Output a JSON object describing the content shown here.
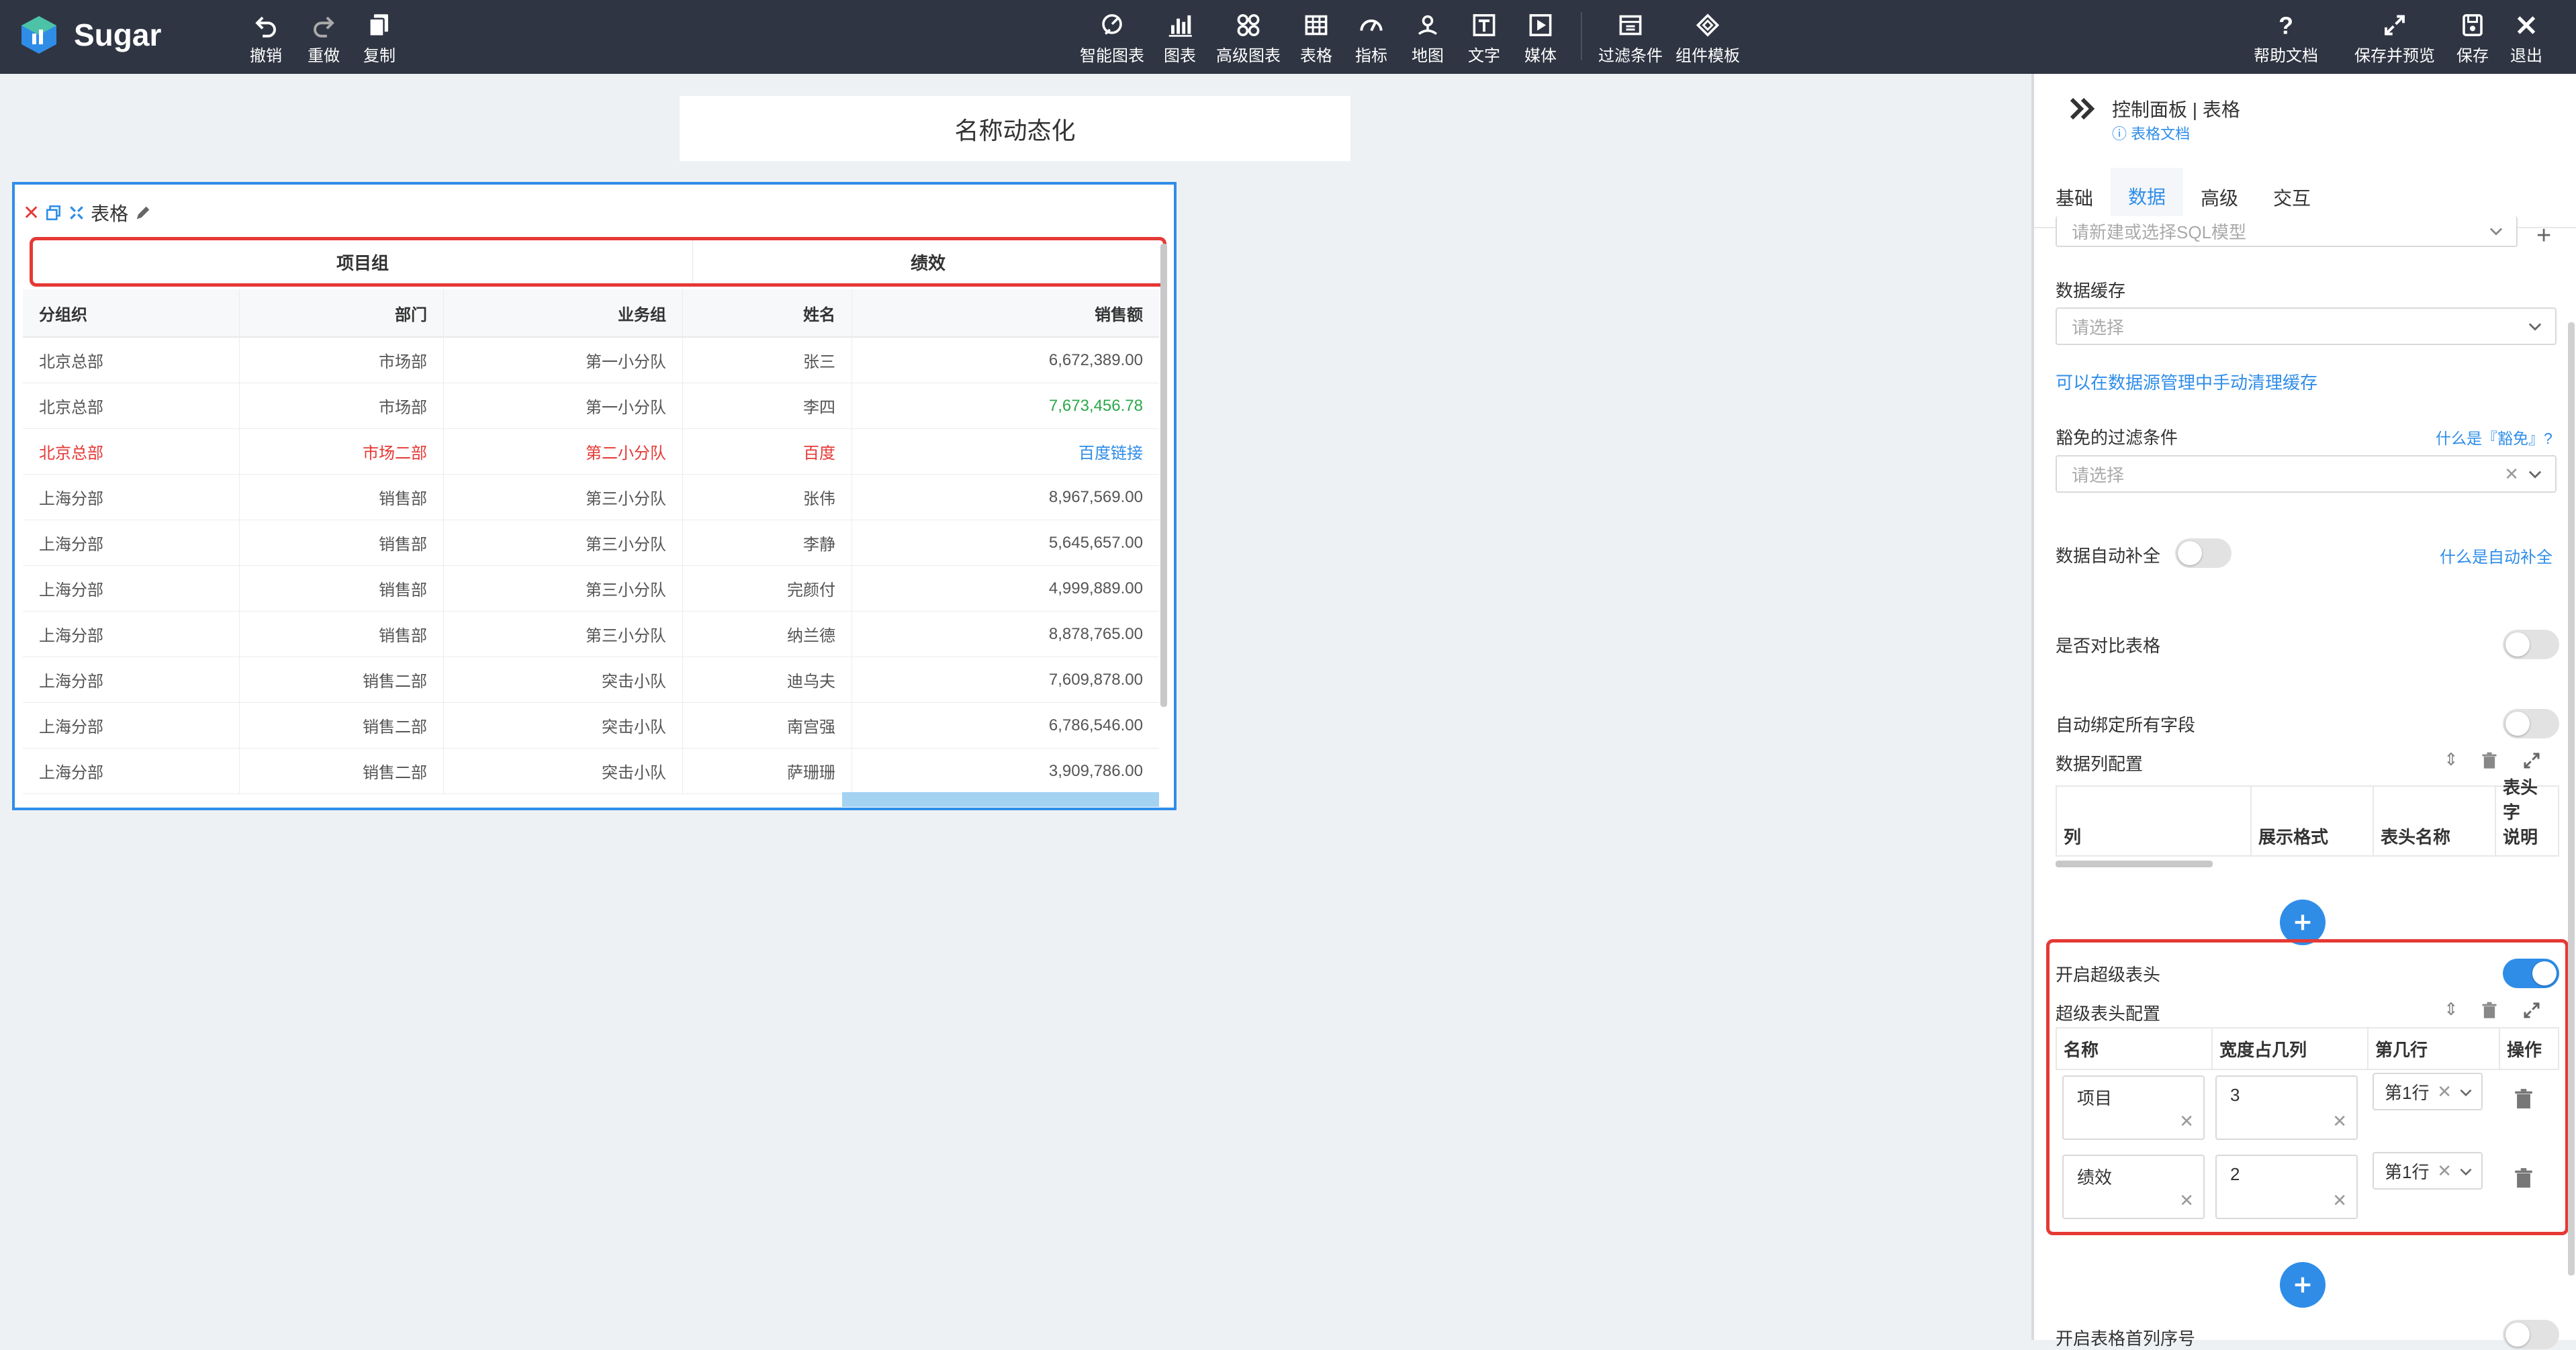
{
  "app": {
    "name": "Sugar"
  },
  "toolbar": {
    "undo": "撤销",
    "redo": "重做",
    "copy": "复制",
    "smart_chart": "智能图表",
    "chart": "图表",
    "advanced_chart": "高级图表",
    "table": "表格",
    "metric": "指标",
    "map": "地图",
    "text": "文字",
    "media": "媒体",
    "filter": "过滤条件",
    "template": "组件模板",
    "help": "帮助文档",
    "save_preview": "保存并预览",
    "save": "保存",
    "exit": "退出"
  },
  "canvas": {
    "title": "名称动态化",
    "widget": {
      "label": "表格",
      "super_headers": [
        "项目组",
        "绩效"
      ],
      "columns": [
        "分组织",
        "部门",
        "业务组",
        "姓名",
        "销售额"
      ],
      "rows": [
        [
          "北京总部",
          "市场部",
          "第一小分队",
          "张三",
          "6,672,389.00"
        ],
        [
          "北京总部",
          "市场部",
          "第一小分队",
          "李四",
          "7,673,456.78"
        ],
        [
          "北京总部",
          "市场二部",
          "第二小分队",
          "百度",
          "百度链接"
        ],
        [
          "上海分部",
          "销售部",
          "第三小分队",
          "张伟",
          "8,967,569.00"
        ],
        [
          "上海分部",
          "销售部",
          "第三小分队",
          "李静",
          "5,645,657.00"
        ],
        [
          "上海分部",
          "销售部",
          "第三小分队",
          "完颜付",
          "4,999,889.00"
        ],
        [
          "上海分部",
          "销售部",
          "第三小分队",
          "纳兰德",
          "8,878,765.00"
        ],
        [
          "上海分部",
          "销售二部",
          "突击小队",
          "迪乌夫",
          "7,609,878.00"
        ],
        [
          "上海分部",
          "销售二部",
          "突击小队",
          "南宫强",
          "6,786,546.00"
        ],
        [
          "上海分部",
          "销售二部",
          "突击小队",
          "萨珊珊",
          "3,909,786.00"
        ]
      ]
    }
  },
  "panel": {
    "title": "控制面板 | 表格",
    "doc_link": "表格文档",
    "tabs": [
      "基础",
      "数据",
      "高级",
      "交互"
    ],
    "sql_placeholder": "请新建或选择SQL模型",
    "cache_label": "数据缓存",
    "cache_placeholder": "请选择",
    "cache_link": "可以在数据源管理中手动清理缓存",
    "exempt_label": "豁免的过滤条件",
    "exempt_link": "什么是『豁免』?",
    "exempt_placeholder": "请选择",
    "autofill_label": "数据自动补全",
    "autofill_link": "什么是自动补全",
    "compare_label": "是否对比表格",
    "autobind_label": "自动绑定所有字段",
    "columns_config_label": "数据列配置",
    "columns_headers": [
      "列",
      "展示格式",
      "表头名称",
      "表头字",
      "说明"
    ],
    "super_header_toggle": "开启超级表头",
    "super_header_config": "超级表头配置",
    "super_header_cols": [
      "名称",
      "宽度占几列",
      "第几行",
      "操作"
    ],
    "super_header_rows": [
      {
        "name": "项目",
        "width": "3",
        "row": "第1行"
      },
      {
        "name": "绩效",
        "width": "2",
        "row": "第1行"
      }
    ],
    "serial_label": "开启表格首列序号"
  }
}
